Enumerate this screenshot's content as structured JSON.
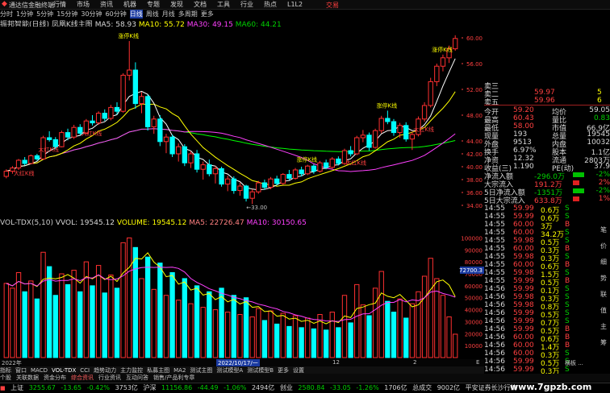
{
  "window": {
    "app_name": "通达信金融终端",
    "trade_btn": "交易"
  },
  "menu": [
    "行情",
    "市场",
    "资讯",
    "机器",
    "专题",
    "发现",
    "文档",
    "工具",
    "行业",
    "热点",
    "L1L2"
  ],
  "period_tabs": [
    "分时",
    "1分钟",
    "5分钟",
    "15分钟",
    "30分钟",
    "60分钟",
    "日线",
    "周线",
    "月线",
    "多周期",
    "更多"
  ],
  "chart_header": {
    "name": "振邦智能(日线)",
    "indicator": "凤凰K线主图",
    "ma5": "MA5: 58.93",
    "ma10": "MA10: 55.72",
    "ma30": "MA30: 49.15",
    "ma60": "MA60: 44.21"
  },
  "price_axis": [
    "60.00",
    "56.00",
    "52.00",
    "48.00",
    "44.00",
    "42.00",
    "40.00",
    "38.00",
    "36.00",
    "34.00"
  ],
  "annotations": [
    {
      "text": "大红K线"
    },
    {
      "text": "大红K线"
    },
    {
      "text": "涨停K线"
    },
    {
      "text": "大红K线"
    },
    {
      "text": "涨停K线"
    },
    {
      "text": "大红K线"
    },
    {
      "text": "涨停K线"
    },
    {
      "text": "大红K线"
    },
    {
      "text": "涨停K线"
    }
  ],
  "low_label": "33.00",
  "vol_header": {
    "name": "VOL-TDX(5,10)",
    "vvol": "VVOL: 19545.12",
    "volume": "VOLUME: 19545.12",
    "ma5": "MA5: 22726.47",
    "ma10": "MA10: 30150.65"
  },
  "vol_axis": [
    "100000",
    "90000",
    "80000",
    "70000",
    "60000",
    "50000",
    "40000",
    "30000",
    "20000",
    "10000"
  ],
  "vol_cursor": "72700.3",
  "x_axis": {
    "left": "2022年",
    "mid": "2022/10/17/一",
    "m2": "12",
    "m3": "2",
    "m4": "E"
  },
  "quotes": {
    "asks": [
      {
        "label": "卖三",
        "price": "",
        "vol": ""
      },
      {
        "label": "卖二",
        "price": "59.97",
        "vol": "5"
      },
      {
        "label": "卖五",
        "price": "59.96",
        "vol": "6"
      }
    ],
    "stats": [
      {
        "l1": "今开",
        "v1": "59.20",
        "l2": "均价",
        "v2": "59.05"
      },
      {
        "l1": "最高",
        "v1": "60.43",
        "l2": "量比",
        "v2": "0.83"
      },
      {
        "l1": "最低",
        "v1": "58.00",
        "l2": "市值",
        "v2": "66.9亿"
      },
      {
        "l1": "现量",
        "v1": "193",
        "l2": "总量",
        "v2": "19545"
      },
      {
        "l1": "外盘",
        "v1": "9513",
        "l2": "内盘",
        "v2": "10032"
      },
      {
        "l1": "换手",
        "v1": "6.97%",
        "l2": "股本",
        "v2": "1.1亿"
      },
      {
        "l1": "净资",
        "v1": "12.32",
        "l2": "流通",
        "v2": "2803万"
      },
      {
        "l1": "收益(三)",
        "v1": "1.190",
        "l2": "PE(动)",
        "v2": "37.9"
      }
    ],
    "flows": [
      {
        "label": "净流入额",
        "value": "-296.0万",
        "pct": "-2%"
      },
      {
        "label": "大宗流入",
        "value": "191.2万",
        "pct": "2%"
      },
      {
        "label": "5日净流入额",
        "value": "-1351万",
        "pct": "-2%"
      },
      {
        "label": "5日大宗流入",
        "value": "633.8万",
        "pct": "1%"
      }
    ],
    "ticks": [
      {
        "time": "14:55",
        "price": "59.99",
        "vol": "0.6万",
        "side": "S"
      },
      {
        "time": "14:55",
        "price": "59.99",
        "vol": "0.6万",
        "side": "S"
      },
      {
        "time": "14:55",
        "price": "60.00",
        "vol": "3万",
        "side": "B"
      },
      {
        "time": "14:55",
        "price": "60.00",
        "vol": "34.2万",
        "side": "S"
      },
      {
        "time": "14:55",
        "price": "59.98",
        "vol": "0.5万",
        "side": "S"
      },
      {
        "time": "14:55",
        "price": "60.00",
        "vol": "0.3万",
        "side": "B"
      },
      {
        "time": "14:55",
        "price": "59.98",
        "vol": "0.3万",
        "side": "S"
      },
      {
        "time": "14:55",
        "price": "60.00",
        "vol": "0.6万",
        "side": "B"
      },
      {
        "time": "14:55",
        "price": "59.98",
        "vol": "1.5万",
        "side": "S"
      },
      {
        "time": "14:55",
        "price": "59.99",
        "vol": "0.5万",
        "side": "B"
      },
      {
        "time": "14:56",
        "price": "59.99",
        "vol": "0.1万",
        "side": "S"
      },
      {
        "time": "14:56",
        "price": "59.98",
        "vol": "0.3万",
        "side": "S"
      },
      {
        "time": "14:56",
        "price": "59.98",
        "vol": "0.8万",
        "side": "S"
      },
      {
        "time": "14:56",
        "price": "59.99",
        "vol": "0.5万",
        "side": "S"
      },
      {
        "time": "14:56",
        "price": "59.99",
        "vol": "0.7万",
        "side": "S"
      },
      {
        "time": "14:56",
        "price": "59.99",
        "vol": "0.5万",
        "side": "B"
      },
      {
        "time": "14:56",
        "price": "60.00",
        "vol": "0.6万",
        "side": "B"
      },
      {
        "time": "14:56",
        "price": "60.00",
        "vol": "1.4万",
        "side": "B"
      },
      {
        "time": "14:56",
        "price": "60.00",
        "vol": "0.3万",
        "side": "S"
      },
      {
        "time": "14:56",
        "price": "59.99",
        "vol": "0.5万",
        "side": "S"
      },
      {
        "time": "14:56",
        "price": "59.99",
        "vol": "0.3万",
        "side": "S"
      }
    ]
  },
  "bottom_tabs": [
    "指标",
    "窗口",
    "MACD",
    "VOL-TDX",
    "CCI",
    "趋势动力",
    "主力监控",
    "私募主图",
    "MA2",
    "测试主图",
    "测试模型A",
    "测试模型B",
    "更多",
    "设置"
  ],
  "bottom_tabs2": [
    "个股",
    "关联数据",
    "资金分布",
    "综合资讯",
    "行业资讯",
    "互动问答",
    "销售/产品利专章"
  ],
  "right_tabs": [
    "笔",
    "价",
    "细",
    "势",
    "联",
    "值",
    "主",
    "筹"
  ],
  "right_misc": "横板 ...",
  "status": {
    "sh_label": "上证",
    "sh_val": "3255.67",
    "sh_chg": "-13.65",
    "sh_pct": "-0.42%",
    "sh_amt": "3753亿",
    "sz_label": "沪深",
    "sz_val": "11156.86",
    "sz_chg": "-44.49",
    "sz_pct": "-1.06%",
    "sz_amt": "2494亿",
    "cy_label": "创业",
    "cy_val": "2580.84",
    "cy_chg": "-33.05",
    "cy_pct": "-1.26%",
    "cy_amt": "1706亿",
    "zc_label": "总成交",
    "zc_val": "9002亿",
    "news": "平安证券长沙行情"
  },
  "watermark": "www.7gpzb.com",
  "chart_data": {
    "type": "candlestick",
    "title": "振邦智能(日线)",
    "ylim": [
      33,
      61
    ],
    "candles": [
      [
        38.5,
        39.6,
        38.2,
        39.3
      ],
      [
        39.3,
        40.1,
        38.9,
        39.8
      ],
      [
        39.8,
        41.2,
        39.5,
        41.0
      ],
      [
        41.0,
        41.5,
        40.2,
        40.5
      ],
      [
        40.5,
        41.9,
        40.4,
        41.7
      ],
      [
        41.7,
        42.0,
        40.9,
        41.2
      ],
      [
        41.2,
        44.8,
        41.1,
        44.5
      ],
      [
        44.5,
        45.5,
        43.9,
        44.2
      ],
      [
        44.2,
        44.6,
        42.7,
        43.1
      ],
      [
        43.1,
        45.6,
        43.0,
        45.3
      ],
      [
        45.3,
        45.9,
        44.1,
        44.6
      ],
      [
        44.6,
        46.5,
        44.3,
        46.1
      ],
      [
        46.1,
        46.6,
        44.9,
        45.2
      ],
      [
        45.2,
        47.4,
        45.0,
        47.1
      ],
      [
        47.1,
        48.0,
        46.4,
        46.8
      ],
      [
        46.8,
        48.6,
        46.5,
        48.3
      ],
      [
        48.3,
        48.9,
        47.1,
        47.5
      ],
      [
        47.5,
        49.6,
        47.2,
        49.2
      ],
      [
        49.2,
        50.0,
        48.1,
        48.6
      ],
      [
        48.6,
        54.5,
        48.4,
        54.2
      ],
      [
        54.2,
        59.5,
        53.4,
        55.0
      ],
      [
        55.0,
        56.2,
        49.0,
        49.8
      ],
      [
        49.8,
        51.6,
        48.3,
        50.9
      ],
      [
        50.9,
        51.2,
        45.6,
        46.2
      ],
      [
        46.2,
        47.9,
        45.1,
        47.4
      ],
      [
        47.4,
        48.0,
        43.2,
        43.9
      ],
      [
        43.9,
        45.1,
        42.1,
        44.6
      ],
      [
        44.6,
        45.0,
        41.5,
        42.0
      ],
      [
        42.0,
        43.6,
        40.8,
        43.1
      ],
      [
        43.1,
        43.5,
        40.1,
        40.6
      ],
      [
        40.6,
        42.4,
        39.8,
        42.0
      ],
      [
        42.0,
        42.6,
        39.1,
        39.6
      ],
      [
        39.6,
        40.8,
        38.0,
        40.3
      ],
      [
        40.3,
        41.1,
        38.5,
        38.9
      ],
      [
        38.9,
        40.1,
        37.4,
        39.7
      ],
      [
        39.7,
        40.0,
        36.9,
        37.3
      ],
      [
        37.3,
        38.6,
        36.2,
        38.1
      ],
      [
        38.1,
        38.5,
        35.8,
        36.3
      ],
      [
        36.3,
        37.5,
        35.5,
        37.0
      ],
      [
        37.0,
        37.2,
        34.6,
        35.1
      ],
      [
        35.1,
        36.5,
        34.2,
        36.1
      ],
      [
        36.1,
        37.8,
        35.8,
        37.5
      ],
      [
        37.5,
        38.0,
        36.4,
        36.8
      ],
      [
        36.8,
        38.4,
        36.5,
        38.1
      ],
      [
        38.1,
        38.6,
        37.1,
        37.4
      ],
      [
        37.4,
        39.0,
        37.2,
        38.8
      ],
      [
        38.8,
        39.5,
        37.9,
        38.2
      ],
      [
        38.2,
        39.8,
        38.0,
        39.5
      ],
      [
        39.5,
        40.0,
        38.5,
        38.9
      ],
      [
        38.9,
        40.3,
        38.7,
        40.1
      ],
      [
        40.1,
        40.4,
        38.9,
        39.3
      ],
      [
        39.3,
        40.9,
        39.1,
        40.6
      ],
      [
        40.6,
        41.1,
        39.6,
        39.9
      ],
      [
        39.9,
        41.5,
        39.7,
        41.2
      ],
      [
        41.2,
        41.6,
        40.2,
        40.5
      ],
      [
        40.5,
        42.8,
        40.3,
        42.5
      ],
      [
        42.5,
        43.2,
        41.6,
        42.0
      ],
      [
        42.0,
        44.8,
        41.8,
        44.5
      ],
      [
        44.5,
        45.7,
        43.8,
        44.9
      ],
      [
        44.9,
        45.3,
        42.5,
        43.0
      ],
      [
        43.0,
        45.9,
        42.8,
        45.6
      ],
      [
        45.6,
        47.9,
        45.2,
        47.5
      ],
      [
        47.5,
        48.7,
        46.6,
        47.0
      ],
      [
        47.0,
        47.4,
        44.8,
        45.3
      ],
      [
        45.3,
        46.8,
        44.5,
        46.4
      ],
      [
        46.4,
        46.9,
        43.9,
        44.3
      ],
      [
        44.3,
        45.4,
        42.6,
        45.0
      ],
      [
        45.0,
        47.8,
        44.7,
        47.4
      ],
      [
        47.4,
        50.0,
        47.0,
        49.5
      ],
      [
        49.5,
        53.8,
        49.2,
        53.2
      ],
      [
        53.2,
        56.0,
        52.5,
        55.6
      ],
      [
        55.6,
        57.4,
        54.8,
        56.9
      ],
      [
        56.9,
        58.8,
        56.1,
        58.3
      ],
      [
        58.3,
        60.4,
        58.0,
        59.9
      ]
    ],
    "volume": [
      62000,
      58000,
      71000,
      55000,
      64000,
      49000,
      88000,
      76000,
      52000,
      70000,
      61000,
      73000,
      55000,
      80000,
      60000,
      77000,
      54000,
      69000,
      58000,
      96000,
      100000,
      92000,
      66000,
      84000,
      57000,
      79000,
      52000,
      71000,
      48000,
      66000,
      45000,
      60000,
      42000,
      55000,
      40000,
      58000,
      38000,
      52000,
      36000,
      50000,
      34000,
      41000,
      31000,
      39000,
      28000,
      37000,
      26000,
      35000,
      25000,
      33000,
      24000,
      36000,
      23000,
      38000,
      25000,
      52000,
      29000,
      61000,
      44000,
      35000,
      58000,
      72000,
      47000,
      38000,
      49000,
      33000,
      45000,
      55000,
      68000,
      83000,
      66000,
      52000,
      34000,
      19545
    ],
    "ma_lines": [
      "MA5",
      "MA10",
      "MA30",
      "MA60"
    ]
  },
  "colors": {
    "up": "#ff3030",
    "down": "#00ffff",
    "ma5": "#ffffff",
    "ma10": "#ffff00",
    "ma30": "#ff40ff",
    "ma60": "#00ff00",
    "bg": "#000000"
  }
}
